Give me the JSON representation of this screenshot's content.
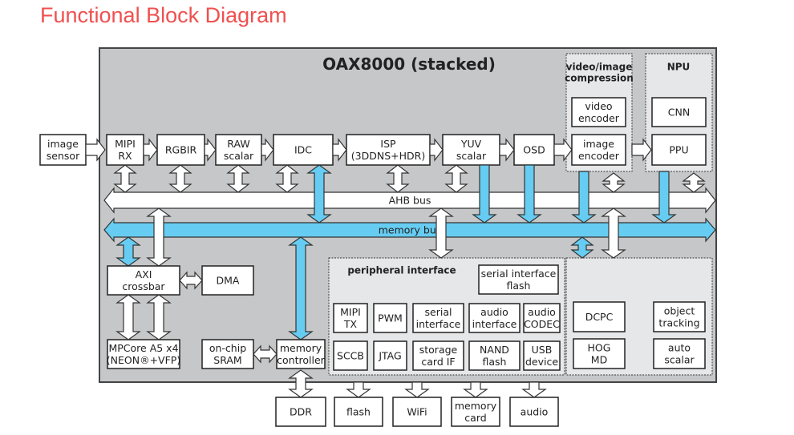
{
  "title": "Functional Block Diagram",
  "chip": {
    "label": "OAX8000 (stacked)"
  },
  "colors": {
    "title": "#f05050",
    "chip_bg": "#c6c7c8",
    "group_bg": "#e6e7e8",
    "memory_bus": "#66ccf2",
    "ahb_bus": "#ffffff"
  },
  "external_inputs": [
    {
      "id": "image-sensor",
      "lines": [
        "image",
        "sensor"
      ]
    }
  ],
  "pipeline": [
    {
      "id": "mipi-rx",
      "lines": [
        "MIPI",
        "RX"
      ]
    },
    {
      "id": "rgbir",
      "lines": [
        "RGBIR"
      ]
    },
    {
      "id": "raw-scalar",
      "lines": [
        "RAW",
        "scalar"
      ]
    },
    {
      "id": "idc",
      "lines": [
        "IDC"
      ]
    },
    {
      "id": "isp",
      "lines": [
        "ISP",
        "(3DDNS+HDR)"
      ]
    },
    {
      "id": "yuv-scalar",
      "lines": [
        "YUV",
        "scalar"
      ]
    },
    {
      "id": "osd",
      "lines": [
        "OSD"
      ]
    }
  ],
  "groups": {
    "compression": {
      "title_lines": [
        "video/image",
        "compression"
      ],
      "blocks": [
        {
          "id": "video-encoder",
          "lines": [
            "video",
            "encoder"
          ]
        },
        {
          "id": "image-encoder",
          "lines": [
            "image",
            "encoder"
          ]
        }
      ]
    },
    "npu": {
      "title_lines": [
        "NPU"
      ],
      "blocks": [
        {
          "id": "cnn",
          "lines": [
            "CNN"
          ]
        },
        {
          "id": "ppu",
          "lines": [
            "PPU"
          ]
        }
      ]
    },
    "peripheral": {
      "title_lines": [
        "peripheral interface"
      ],
      "blocks": [
        {
          "id": "serial-interface-flash",
          "lines": [
            "serial interface",
            "flash"
          ]
        },
        {
          "id": "mipi-tx",
          "lines": [
            "MIPI",
            "TX"
          ]
        },
        {
          "id": "pwm",
          "lines": [
            "PWM"
          ]
        },
        {
          "id": "serial-interface",
          "lines": [
            "serial",
            "interface"
          ]
        },
        {
          "id": "audio-interface",
          "lines": [
            "audio",
            "interface"
          ]
        },
        {
          "id": "audio-codec",
          "lines": [
            "audio",
            "CODEC"
          ]
        },
        {
          "id": "sccb",
          "lines": [
            "SCCB"
          ]
        },
        {
          "id": "jtag",
          "lines": [
            "JTAG"
          ]
        },
        {
          "id": "storage-card-if",
          "lines": [
            "storage",
            "card IF"
          ]
        },
        {
          "id": "nand-flash",
          "lines": [
            "NAND",
            "flash"
          ]
        },
        {
          "id": "usb-device",
          "lines": [
            "USB",
            "device"
          ]
        }
      ]
    },
    "vision": {
      "title_lines": [],
      "blocks": [
        {
          "id": "dcpc",
          "lines": [
            "DCPC"
          ]
        },
        {
          "id": "object-tracking",
          "lines": [
            "object",
            "tracking"
          ]
        },
        {
          "id": "hog-md",
          "lines": [
            "HOG",
            "MD"
          ]
        },
        {
          "id": "auto-scalar",
          "lines": [
            "auto",
            "scalar"
          ]
        }
      ]
    }
  },
  "buses": {
    "ahb": "AHB bus",
    "memory": "memory bus"
  },
  "system": [
    {
      "id": "axi-crossbar",
      "lines": [
        "AXI",
        "crossbar"
      ]
    },
    {
      "id": "dma",
      "lines": [
        "DMA"
      ]
    },
    {
      "id": "mpcore",
      "lines": [
        "MPCore A5 x4",
        "(NEON®+VFP)"
      ]
    },
    {
      "id": "on-chip-sram",
      "lines": [
        "on-chip",
        "SRAM"
      ]
    },
    {
      "id": "memory-controller",
      "lines": [
        "memory",
        "controller"
      ]
    }
  ],
  "external_outputs": [
    {
      "id": "ddr",
      "lines": [
        "DDR"
      ]
    },
    {
      "id": "flash",
      "lines": [
        "flash"
      ]
    },
    {
      "id": "wifi",
      "lines": [
        "WiFi"
      ]
    },
    {
      "id": "memory-card",
      "lines": [
        "memory",
        "card"
      ]
    },
    {
      "id": "audio",
      "lines": [
        "audio"
      ]
    }
  ]
}
